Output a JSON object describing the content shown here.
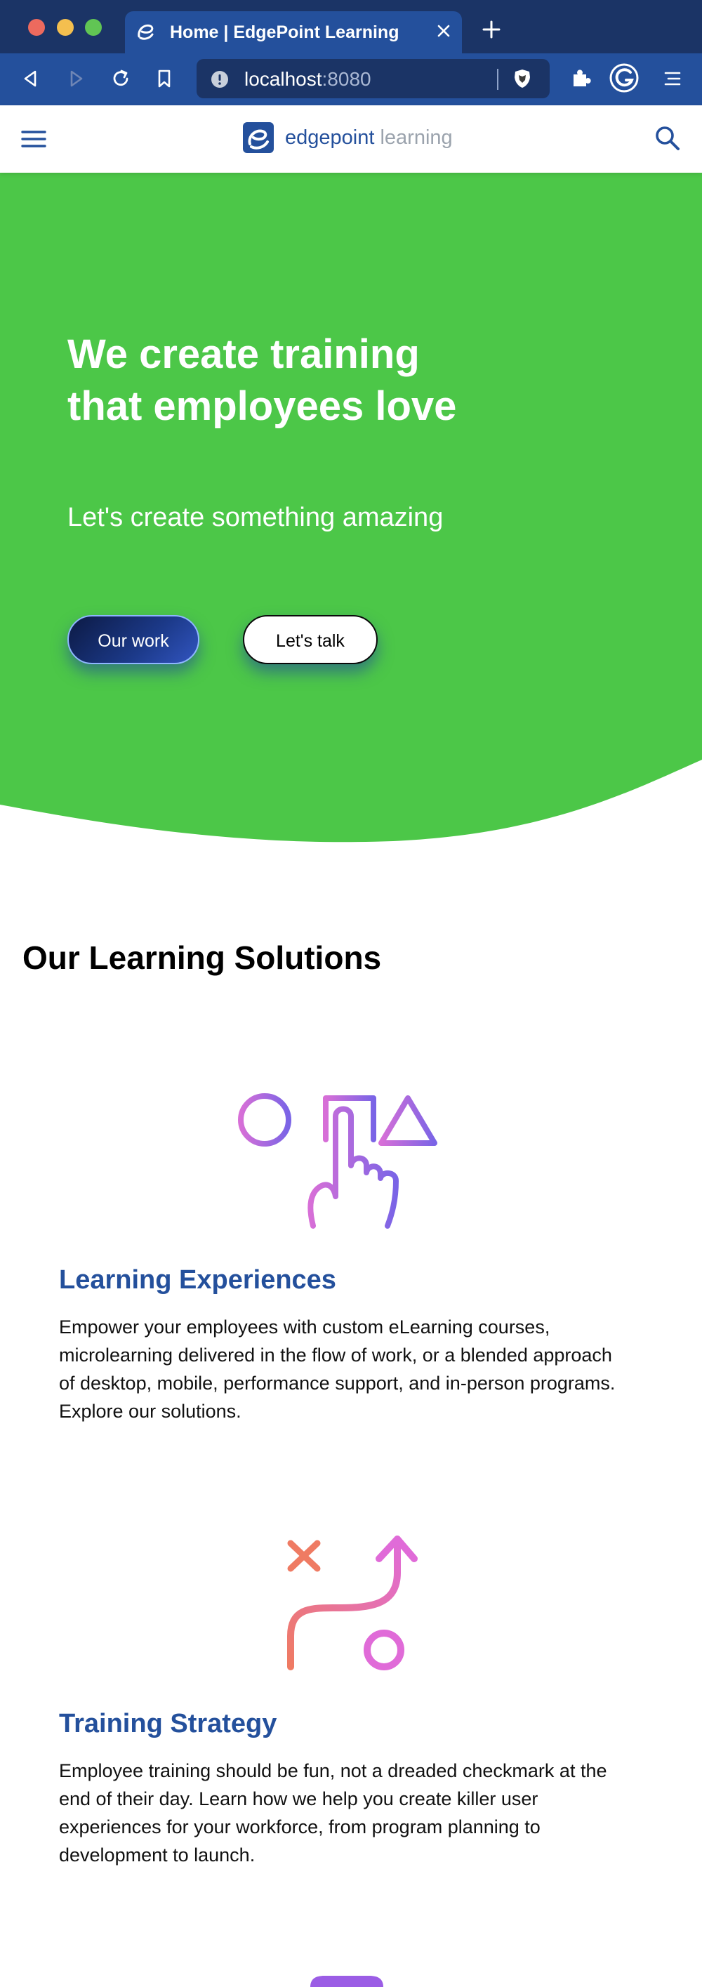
{
  "browser": {
    "tab": {
      "title": "Home | EdgePoint Learning",
      "favicon": "edgepoint-e-icon"
    },
    "address": {
      "host": "localhost",
      "port": ":8080"
    },
    "colors": {
      "frame": "#1b3466",
      "toolbar": "#24509c"
    }
  },
  "header": {
    "logo": {
      "word1": "edgepoint",
      "word2": " learning"
    },
    "menu_icon": "hamburger-icon",
    "search_icon": "search-icon"
  },
  "hero": {
    "title": "We create training that employees love",
    "subtitle": "Let's create something amazing",
    "primary_button": "Our work",
    "secondary_button": "Let's talk",
    "background_color": "#4cc748"
  },
  "solutions": {
    "heading": "Our Learning Solutions",
    "items": [
      {
        "title": "Learning Experiences",
        "description": "Empower your employees with custom eLearning courses, microlearning delivered in the flow of work, or a blended approach of desktop, mobile, performance support, and in-person programs. Explore our solutions.",
        "icon": "pointer-shapes-icon"
      },
      {
        "title": "Training Strategy",
        "description": "Employee training should be fun, not a dreaded checkmark at the end of their day. Learn how we help you create killer user experiences for your workforce, from program planning to development to launch.",
        "icon": "strategy-path-icon"
      }
    ]
  }
}
